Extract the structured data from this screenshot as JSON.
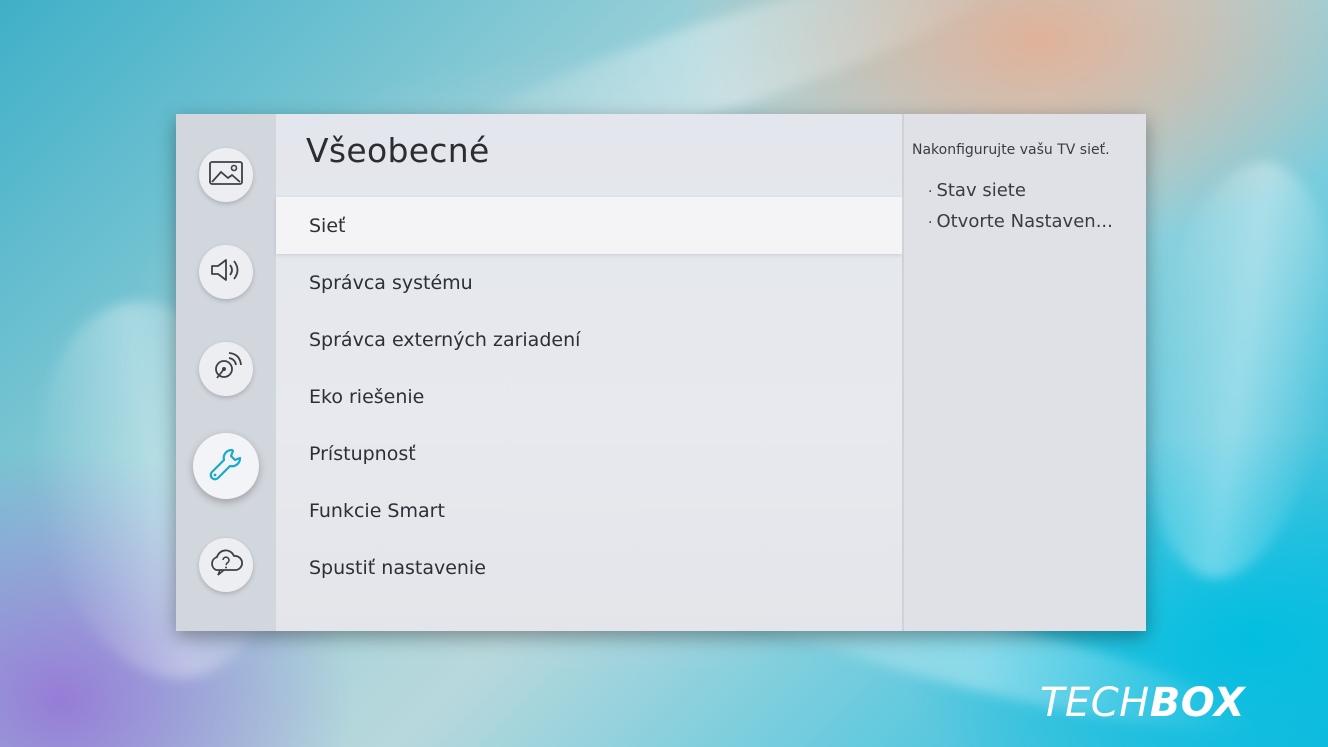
{
  "settings": {
    "title": "Všeobecné",
    "sidebar": [
      {
        "icon": "picture-icon",
        "active": false
      },
      {
        "icon": "sound-icon",
        "active": false
      },
      {
        "icon": "broadcast-icon",
        "active": false
      },
      {
        "icon": "wrench-icon",
        "active": true
      },
      {
        "icon": "support-icon",
        "active": false
      }
    ],
    "menu": [
      {
        "label": "Sieť",
        "selected": true
      },
      {
        "label": "Správca systému",
        "selected": false
      },
      {
        "label": "Správca externých zariadení",
        "selected": false
      },
      {
        "label": "Eko riešenie",
        "selected": false
      },
      {
        "label": "Prístupnosť",
        "selected": false
      },
      {
        "label": "Funkcie Smart",
        "selected": false
      },
      {
        "label": "Spustiť nastavenie",
        "selected": false
      }
    ],
    "info": {
      "description": "Nakonfigurujte vašu TV sieť.",
      "items": [
        "Stav siete",
        "Otvorte Nastaven..."
      ]
    }
  },
  "watermark": {
    "part1": "TECH",
    "part2": "BOX"
  },
  "colors": {
    "accent": "#1aa9c9",
    "panel": "#e5e7ec",
    "sidebar": "#d2d6dd"
  }
}
